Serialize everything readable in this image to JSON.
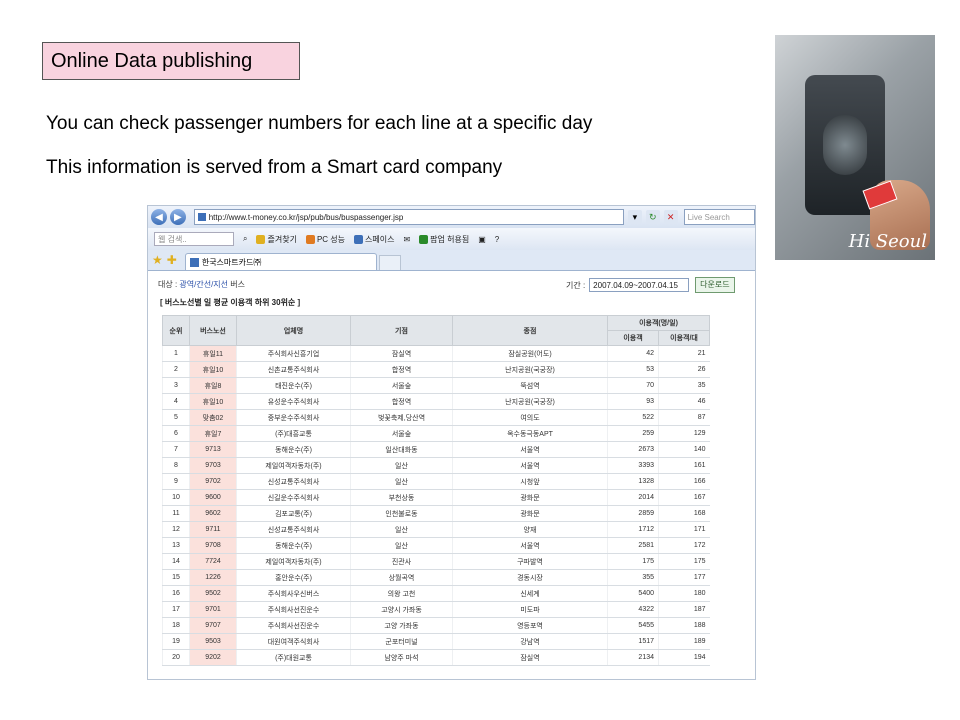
{
  "slide": {
    "title": "Online Data publishing",
    "line1": "You can check passenger numbers for each line at a specific day",
    "line2": "This information is served from a Smart card company"
  },
  "photo": {
    "logo": "Hi Seoul"
  },
  "browser": {
    "url": "http://www.t-money.co.kr/jsp/pub/bus/buspassenger.jsp",
    "search_placeholder": "Live Search",
    "toolbar_search": "웹 검색..",
    "toolbar_items": [
      "즐겨찾기",
      "PC 성능",
      "스페이스",
      "팝업 허용됨"
    ],
    "tab_title": "한국스마트카드㈜",
    "crumb_prefix": "대상 :",
    "crumb_link": "광역/간선/지선",
    "crumb_suffix": "버스",
    "period_label": "기간 :",
    "period_value": "2007.04.09~2007.04.15",
    "download_label": "다운로드",
    "table_title": "[ 버스노선별 일 평균 이용객 하위 30위순 ]"
  },
  "table": {
    "headers": {
      "rank": "순위",
      "route": "버스노선",
      "company": "업체명",
      "origin": "기점",
      "terminus": "종점",
      "riders": "이용객(명/일)",
      "riders_total": "이용객",
      "riders_per_bus": "이용객/대"
    },
    "rows": [
      {
        "rank": "1",
        "route": "휴일11",
        "company": "주식회사신흥기업",
        "origin": "잠실역",
        "terminus": "잠실공원(어도)",
        "riders": "42",
        "per_bus": "21"
      },
      {
        "rank": "2",
        "route": "휴일10",
        "company": "신촌교통주식회사",
        "origin": "합정역",
        "terminus": "난지공원(국궁장)",
        "riders": "53",
        "per_bus": "26"
      },
      {
        "rank": "3",
        "route": "휴일8",
        "company": "태진운수(주)",
        "origin": "서울숲",
        "terminus": "뚝섬역",
        "riders": "70",
        "per_bus": "35"
      },
      {
        "rank": "4",
        "route": "휴일10",
        "company": "유성운수주식회사",
        "origin": "합정역",
        "terminus": "난지공원(국궁장)",
        "riders": "93",
        "per_bus": "46"
      },
      {
        "rank": "5",
        "route": "맞춤02",
        "company": "중부운수주식회사",
        "origin": "벚꽃축제,당산역",
        "terminus": "여의도",
        "riders": "522",
        "per_bus": "87"
      },
      {
        "rank": "6",
        "route": "휴일7",
        "company": "(주)대흥교통",
        "origin": "서울숲",
        "terminus": "옥수동극동APT",
        "riders": "259",
        "per_bus": "129"
      },
      {
        "rank": "7",
        "route": "9713",
        "company": "동해운수(주)",
        "origin": "일산대화동",
        "terminus": "서울역",
        "riders": "2673",
        "per_bus": "140"
      },
      {
        "rank": "8",
        "route": "9703",
        "company": "제일여객자동차(주)",
        "origin": "일산",
        "terminus": "서울역",
        "riders": "3393",
        "per_bus": "161"
      },
      {
        "rank": "9",
        "route": "9702",
        "company": "신성교통주식회사",
        "origin": "일산",
        "terminus": "시청앞",
        "riders": "1328",
        "per_bus": "166"
      },
      {
        "rank": "10",
        "route": "9600",
        "company": "신길운수주식회사",
        "origin": "부천상동",
        "terminus": "광화문",
        "riders": "2014",
        "per_bus": "167"
      },
      {
        "rank": "11",
        "route": "9602",
        "company": "김포교통(주)",
        "origin": "인천불로동",
        "terminus": "광화문",
        "riders": "2859",
        "per_bus": "168"
      },
      {
        "rank": "12",
        "route": "9711",
        "company": "신성교통주식회사",
        "origin": "일산",
        "terminus": "양재",
        "riders": "1712",
        "per_bus": "171"
      },
      {
        "rank": "13",
        "route": "9708",
        "company": "동해운수(주)",
        "origin": "일산",
        "terminus": "서울역",
        "riders": "2581",
        "per_bus": "172"
      },
      {
        "rank": "14",
        "route": "7724",
        "company": "제일여객자동차(주)",
        "origin": "진관사",
        "terminus": "구파발역",
        "riders": "175",
        "per_bus": "175"
      },
      {
        "rank": "15",
        "route": "1226",
        "company": "홍안운수(주)",
        "origin": "상월곡역",
        "terminus": "경동시장",
        "riders": "355",
        "per_bus": "177"
      },
      {
        "rank": "16",
        "route": "9502",
        "company": "주식회사우신버스",
        "origin": "의왕 고천",
        "terminus": "신세계",
        "riders": "5400",
        "per_bus": "180"
      },
      {
        "rank": "17",
        "route": "9701",
        "company": "주식회사선진운수",
        "origin": "고양시 가좌동",
        "terminus": "미도파",
        "riders": "4322",
        "per_bus": "187"
      },
      {
        "rank": "18",
        "route": "9707",
        "company": "주식회사선진운수",
        "origin": "고양 가좌동",
        "terminus": "영등포역",
        "riders": "5455",
        "per_bus": "188"
      },
      {
        "rank": "19",
        "route": "9503",
        "company": "대원여객주식회사",
        "origin": "군포터미널",
        "terminus": "강남역",
        "riders": "1517",
        "per_bus": "189"
      },
      {
        "rank": "20",
        "route": "9202",
        "company": "(주)대원교통",
        "origin": "남양주 마석",
        "terminus": "잠실역",
        "riders": "2134",
        "per_bus": "194"
      }
    ]
  }
}
